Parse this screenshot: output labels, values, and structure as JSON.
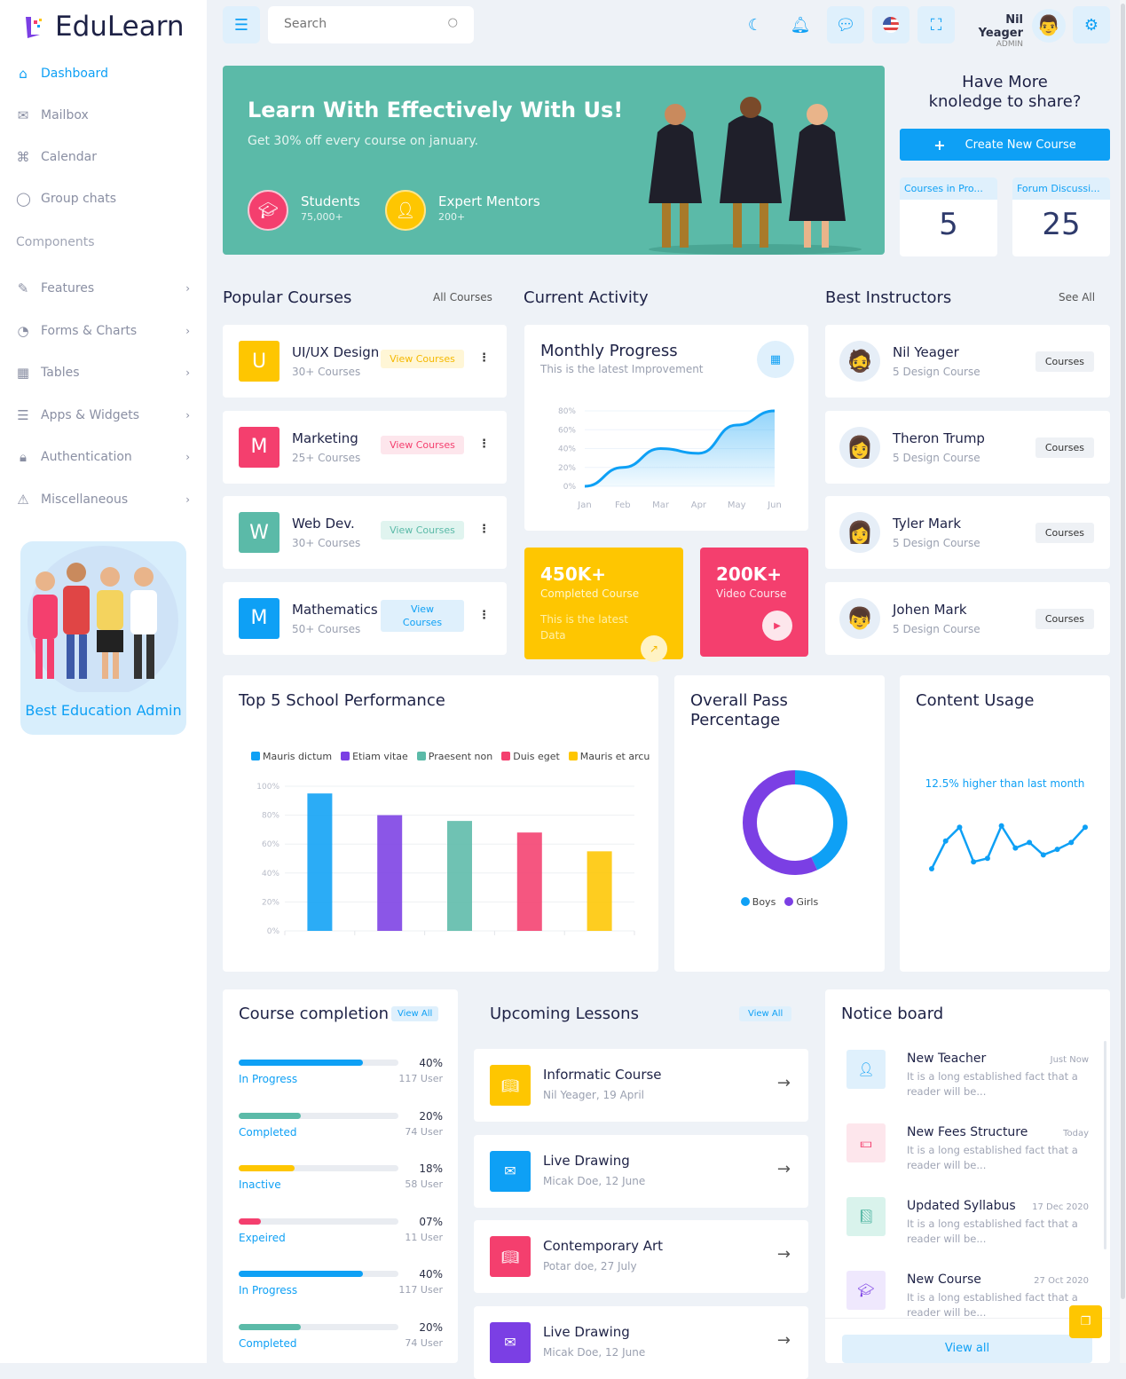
{
  "brand": {
    "name": "EduLearn"
  },
  "sidebar": {
    "items": [
      {
        "label": "Dashboard",
        "icon": "home-icon"
      },
      {
        "label": "Mailbox",
        "icon": "mail-icon"
      },
      {
        "label": "Calendar",
        "icon": "command-icon"
      },
      {
        "label": "Group chats",
        "icon": "chat-icon"
      }
    ],
    "section": "Components",
    "sub_items": [
      {
        "label": "Features",
        "icon": "edit-icon"
      },
      {
        "label": "Forms & Charts",
        "icon": "pie-icon"
      },
      {
        "label": "Tables",
        "icon": "grid-icon"
      },
      {
        "label": "Apps & Widgets",
        "icon": "database-icon"
      },
      {
        "label": "Authentication",
        "icon": "lock-icon"
      },
      {
        "label": "Miscellaneous",
        "icon": "warning-icon"
      }
    ],
    "promo": "Best Education Admin"
  },
  "header": {
    "search_placeholder": "Search",
    "user_name": "Nil Yeager",
    "user_role": "ADMIN"
  },
  "hero": {
    "title": "Learn With Effectively With Us!",
    "subtitle": "Get 30% off every course on january.",
    "stats": [
      {
        "label": "Students",
        "value": "75,000+"
      },
      {
        "label": "Expert Mentors",
        "value": "200+"
      }
    ]
  },
  "share": {
    "title_line1": "Have More",
    "title_line2": "knoledge to share?",
    "button": "Create New Course",
    "stats": [
      {
        "label": "Courses in Pro...",
        "value": "5"
      },
      {
        "label": "Forum Discussi...",
        "value": "25"
      }
    ]
  },
  "popular": {
    "title": "Popular Courses",
    "link": "All Courses",
    "items": [
      {
        "letter": "U",
        "title": "UI/UX Design",
        "sub": "30+ Courses",
        "btn": "View Courses",
        "color": "#fec601",
        "btnbg": "#fff6d6",
        "btncolor": "#f5b800"
      },
      {
        "letter": "M",
        "title": "Marketing",
        "sub": "25+ Courses",
        "btn": "View Courses",
        "color": "#f43f6e",
        "btnbg": "#fde6ec",
        "btncolor": "#f43f6e"
      },
      {
        "letter": "W",
        "title": "Web Dev.",
        "sub": "30+ Courses",
        "btn": "View Courses",
        "color": "#5bbaa8",
        "btnbg": "#e0f4ef",
        "btncolor": "#5bbaa8"
      },
      {
        "letter": "M",
        "title": "Mathematics",
        "sub": "50+ Courses",
        "btn": "View Courses",
        "color": "#0ea0f5",
        "btnbg": "#dff0fc",
        "btncolor": "#0ea0f5"
      }
    ]
  },
  "activity": {
    "title": "Current Activity",
    "card_title": "Monthly Progress",
    "card_sub": "This is the latest Improvement",
    "stat1": {
      "value": "450K+",
      "label": "Completed Course",
      "note": "This is the latest Data"
    },
    "stat2": {
      "value": "200K+",
      "label": "Video Course"
    }
  },
  "instructors": {
    "title": "Best Instructors",
    "link": "See All",
    "button": "Courses",
    "items": [
      {
        "name": "Nil Yeager",
        "sub": "5 Design Course"
      },
      {
        "name": "Theron Trump",
        "sub": "5 Design Course"
      },
      {
        "name": "Tyler Mark",
        "sub": "5 Design Course"
      },
      {
        "name": "Johen Mark",
        "sub": "5 Design Course"
      }
    ]
  },
  "school": {
    "title": "Top 5 School Performance"
  },
  "pass": {
    "title_line1": "Overall Pass",
    "title_line2": "Percentage"
  },
  "usage": {
    "title": "Content Usage",
    "note": "12.5% higher than last month"
  },
  "completion": {
    "title": "Course completion",
    "link": "View All",
    "items": [
      {
        "pct": "40%",
        "value": 40,
        "label": "In Progress",
        "users": "117 User",
        "color": "#0ea0f5"
      },
      {
        "pct": "20%",
        "value": 20,
        "label": "Completed",
        "users": "74 User",
        "color": "#5bbaa8"
      },
      {
        "pct": "18%",
        "value": 18,
        "label": "Inactive",
        "users": "58 User",
        "color": "#fec601"
      },
      {
        "pct": "07%",
        "value": 7,
        "label": "Expeired",
        "users": "11 User",
        "color": "#f43f6e"
      },
      {
        "pct": "40%",
        "value": 40,
        "label": "In Progress",
        "users": "117 User",
        "color": "#0ea0f5"
      },
      {
        "pct": "20%",
        "value": 20,
        "label": "Completed",
        "users": "74 User",
        "color": "#5bbaa8"
      }
    ]
  },
  "lessons": {
    "title": "Upcoming Lessons",
    "link": "View All",
    "items": [
      {
        "title": "Informatic Course",
        "sub": "Nil Yeager, 19 April",
        "color": "#fec601"
      },
      {
        "title": "Live Drawing",
        "sub": "Micak Doe, 12 June",
        "color": "#0ea0f5"
      },
      {
        "title": "Contemporary Art",
        "sub": "Potar doe, 27 July",
        "color": "#f43f6e"
      },
      {
        "title": "Live Drawing",
        "sub": "Micak Doe, 12 June",
        "color": "#7b3fe4"
      }
    ]
  },
  "notice": {
    "title": "Notice board",
    "button": "View all",
    "items": [
      {
        "title": "New Teacher",
        "date": "Just Now",
        "body": "It is a long established fact that a reader will be...",
        "icon": "user-icon",
        "bg": "#dff0fc",
        "fg": "#0ea0f5"
      },
      {
        "title": "New Fees Structure",
        "date": "Today",
        "body": "It is a long established fact that a reader will be...",
        "icon": "money-icon",
        "bg": "#fde6ec",
        "fg": "#f43f6e"
      },
      {
        "title": "Updated Syllabus",
        "date": "17 Dec 2020",
        "body": "It is a long established fact that a reader will be...",
        "icon": "book-icon",
        "bg": "#d9f3ec",
        "fg": "#5bbaa8"
      },
      {
        "title": "New Course",
        "date": "27 Oct 2020",
        "body": "It is a long established fact that a reader will be...",
        "icon": "graduation-cap-icon",
        "bg": "#efe8fd",
        "fg": "#7b3fe4"
      }
    ]
  },
  "chart_data": [
    {
      "type": "area",
      "title": "Monthly Progress",
      "categories": [
        "Jan",
        "Feb",
        "Mar",
        "Apr",
        "May",
        "Jun"
      ],
      "values": [
        0,
        20,
        40,
        35,
        65,
        80
      ],
      "ylim": [
        0,
        80
      ],
      "yticks": [
        "0%",
        "20%",
        "40%",
        "60%",
        "80%"
      ],
      "color": "#0ea0f5",
      "grid": true
    },
    {
      "type": "bar",
      "title": "Top 5 School Performance",
      "categories": [
        "Mauris dictum",
        "Etiam vitae",
        "Praesent non",
        "Duis eget",
        "Mauris et arcu"
      ],
      "values": [
        95,
        80,
        76,
        68,
        55
      ],
      "colors": [
        "#0ea0f5",
        "#7b3fe4",
        "#5bbaa8",
        "#f43f6e",
        "#fec601"
      ],
      "ylim": [
        0,
        100
      ],
      "yticks": [
        "0%",
        "20%",
        "40%",
        "60%",
        "80%",
        "100%"
      ],
      "legend": "top",
      "grid": true
    },
    {
      "type": "pie",
      "title": "Overall Pass Percentage",
      "donut": true,
      "series": [
        {
          "name": "Boys",
          "value": 43,
          "color": "#0ea0f5"
        },
        {
          "name": "Girls",
          "value": 57,
          "color": "#7b3fe4"
        }
      ],
      "legend": "bottom"
    },
    {
      "type": "line",
      "title": "Content Usage",
      "values": [
        0,
        40,
        60,
        10,
        15,
        62,
        30,
        38,
        20,
        28,
        38,
        60
      ],
      "color": "#0ea0f5"
    }
  ]
}
